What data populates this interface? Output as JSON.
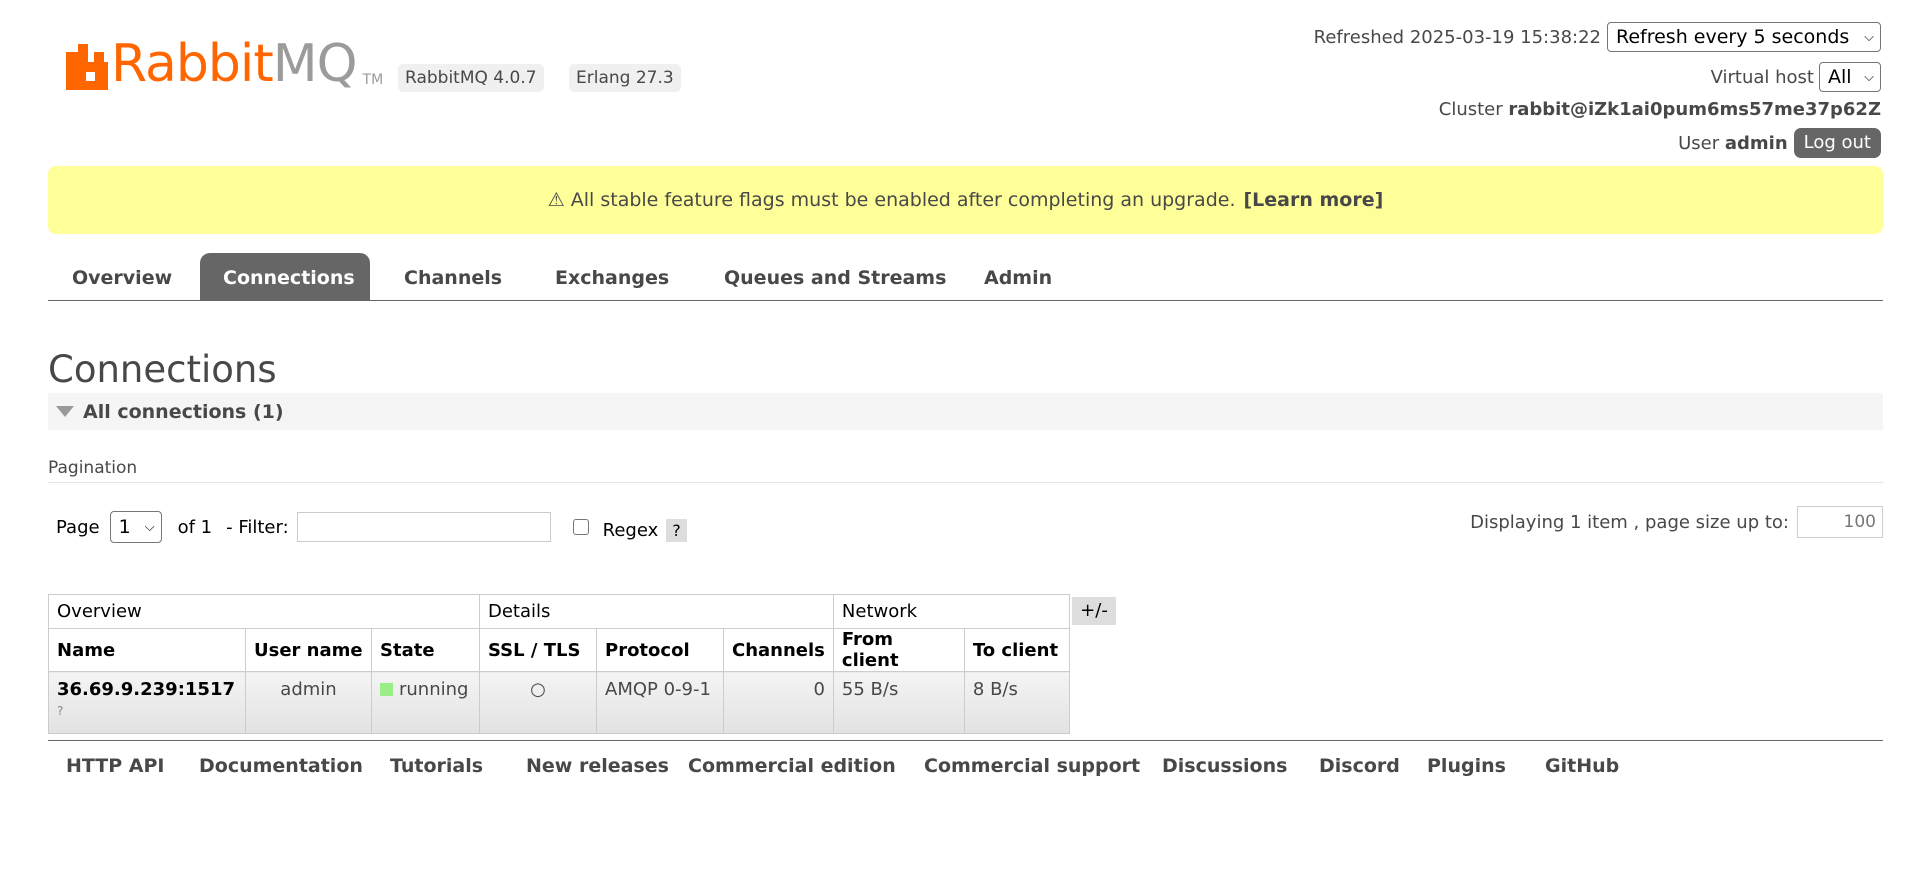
{
  "header": {
    "logo_left": "Rabbit",
    "logo_right": "MQ",
    "logo_tm": "TM",
    "rabbitmq_version": "RabbitMQ 4.0.7",
    "erlang_version": "Erlang 27.3",
    "refreshed": "Refreshed 2025-03-19 15:38:22",
    "refresh_option": "Refresh every 5 seconds",
    "vhost_label": "Virtual host",
    "vhost_value": "All",
    "cluster_label": "Cluster",
    "cluster_name": "rabbit@iZk1ai0pum6ms57me37p62Z",
    "user_label": "User",
    "user_name": "admin",
    "logout_label": "Log out"
  },
  "banner": {
    "message": "⚠ All stable feature flags must be enabled after completing an upgrade.",
    "link": "[Learn more]"
  },
  "tabs": [
    {
      "label": "Overview"
    },
    {
      "label": "Connections"
    },
    {
      "label": "Channels"
    },
    {
      "label": "Exchanges"
    },
    {
      "label": "Queues and Streams"
    },
    {
      "label": "Admin"
    }
  ],
  "page": {
    "title": "Connections",
    "section": "All connections (1)",
    "pagination_title": "Pagination",
    "page_label": "Page",
    "page_value": "1",
    "of_label": "of 1",
    "filter_label": "- Filter:",
    "filter_value": "",
    "regex_label": "Regex",
    "help_label": "?",
    "displaying": "Displaying 1 item , page size up to:",
    "page_size": "100"
  },
  "table": {
    "groups": [
      "Overview",
      "Details",
      "Network"
    ],
    "columns": [
      "Name",
      "User name",
      "State",
      "SSL / TLS",
      "Protocol",
      "Channels",
      "From client",
      "To client"
    ],
    "toggle": "+/-",
    "rows": [
      {
        "name": "36.69.9.239:1517",
        "name_hint": "?",
        "user": "admin",
        "state": "running",
        "ssl": "○",
        "protocol": "AMQP 0-9-1",
        "channels": "0",
        "from_client": "55 B/s",
        "to_client": "8 B/s"
      }
    ]
  },
  "footer": {
    "links": [
      "HTTP API",
      "Documentation",
      "Tutorials",
      "New releases",
      "Commercial edition",
      "Commercial support",
      "Discussions",
      "Discord",
      "Plugins",
      "GitHub"
    ]
  },
  "colors": {
    "brand_orange": "#ff6600",
    "banner_yellow": "#ffff99",
    "tab_active": "#666666",
    "state_running": "#99ee88"
  }
}
